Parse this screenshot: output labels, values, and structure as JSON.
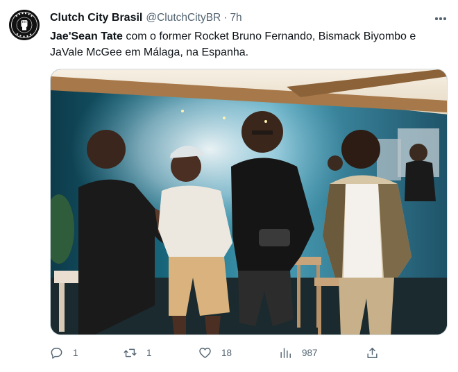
{
  "tweet": {
    "avatar_text": "CLUTCH CITY CULTURE",
    "display_name": "Clutch City Brasil",
    "handle": "@ClutchCityBR",
    "separator": "·",
    "time": "7h",
    "text_bold": "Jae'Sean Tate",
    "text_rest": " com o former Rocket Bruno Fernando, Bismack Biyombo e JaVale McGee em Málaga, na Espanha."
  },
  "actions": {
    "replies": "1",
    "retweets": "1",
    "likes": "18",
    "views": "987"
  },
  "icons": {
    "more": "more-horizontal-icon",
    "reply": "reply-icon",
    "retweet": "retweet-icon",
    "like": "heart-icon",
    "views": "views-icon",
    "share": "share-icon"
  },
  "colors": {
    "text": "#0f1419",
    "secondary": "#536471",
    "border": "#cfd9de"
  }
}
